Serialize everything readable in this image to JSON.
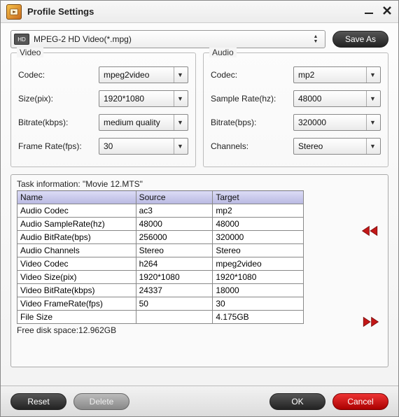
{
  "window": {
    "title": "Profile Settings"
  },
  "toolbar": {
    "profile_text": "MPEG-2 HD Video(*.mpg)",
    "hd_badge": "HD",
    "save_as": "Save As"
  },
  "video": {
    "legend": "Video",
    "codec_label": "Codec:",
    "codec_value": "mpeg2video",
    "size_label": "Size(pix):",
    "size_value": "1920*1080",
    "bitrate_label": "Bitrate(kbps):",
    "bitrate_value": "medium quality",
    "framerate_label": "Frame Rate(fps):",
    "framerate_value": "30"
  },
  "audio": {
    "legend": "Audio",
    "codec_label": "Codec:",
    "codec_value": "mp2",
    "samplerate_label": "Sample Rate(hz):",
    "samplerate_value": "48000",
    "bitrate_label": "Bitrate(bps):",
    "bitrate_value": "320000",
    "channels_label": "Channels:",
    "channels_value": "Stereo"
  },
  "task": {
    "info_label": "Task information: \"Movie 12.MTS\"",
    "headers": {
      "name": "Name",
      "source": "Source",
      "target": "Target"
    },
    "rows": [
      {
        "name": "Audio Codec",
        "source": "ac3",
        "target": "mp2"
      },
      {
        "name": "Audio SampleRate(hz)",
        "source": "48000",
        "target": "48000"
      },
      {
        "name": "Audio BitRate(bps)",
        "source": "256000",
        "target": "320000"
      },
      {
        "name": "Audio Channels",
        "source": "Stereo",
        "target": "Stereo"
      },
      {
        "name": "Video Codec",
        "source": "h264",
        "target": "mpeg2video"
      },
      {
        "name": "Video Size(pix)",
        "source": "1920*1080",
        "target": "1920*1080"
      },
      {
        "name": "Video BitRate(kbps)",
        "source": "24337",
        "target": "18000"
      },
      {
        "name": "Video FrameRate(fps)",
        "source": "50",
        "target": "30"
      },
      {
        "name": "File Size",
        "source": "",
        "target": "4.175GB"
      }
    ],
    "free_disk": "Free disk space:12.962GB"
  },
  "footer": {
    "reset": "Reset",
    "delete": "Delete",
    "ok": "OK",
    "cancel": "Cancel"
  }
}
